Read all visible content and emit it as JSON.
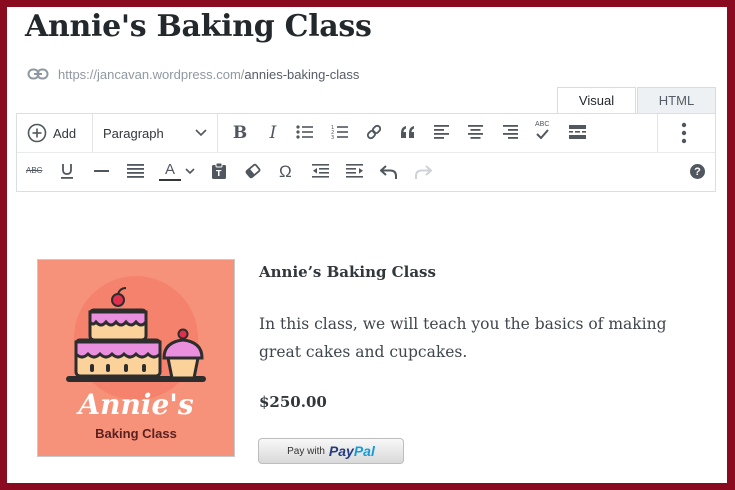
{
  "post": {
    "title": "Annie's Baking Class",
    "permalink_base": "https://jancavan.wordpress.com/",
    "permalink_slug": "annies-baking-class"
  },
  "editor_tabs": [
    {
      "label": "Visual",
      "active": true
    },
    {
      "label": "HTML",
      "active": false
    }
  ],
  "toolbar": {
    "add_label": "Add",
    "format_select": "Paragraph",
    "row1_icons": [
      "bold-icon",
      "italic-icon",
      "bullet-list-icon",
      "numbered-list-icon",
      "link-icon",
      "blockquote-icon",
      "align-left-icon",
      "align-center-icon",
      "align-right-icon",
      "spellcheck-icon",
      "read-more-icon",
      "more-options-icon"
    ],
    "row2_icons": [
      "strikethrough-icon",
      "underline-icon",
      "horizontal-line-icon",
      "justify-icon",
      "text-color-icon",
      "paste-text-icon",
      "clear-formatting-icon",
      "special-character-icon",
      "outdent-icon",
      "indent-icon",
      "undo-icon",
      "redo-icon",
      "help-icon"
    ],
    "strike_glyph": "ABC",
    "spell_glyph": "ABC",
    "textcolor_glyph": "A",
    "omega_glyph": "Ω",
    "help_glyph": "?"
  },
  "product": {
    "name": "Annie’s Baking Class",
    "description": "In this class, we will teach you the basics of making great cakes and cupcakes.",
    "price": "$250.00",
    "image_brand": "Annie's",
    "image_subtitle": "Baking Class",
    "paypal_prefix": "Pay with",
    "paypal_brand_a": "Pay",
    "paypal_brand_b": "Pal"
  },
  "colors": {
    "frame": "#8a0a1f",
    "image_bg": "#f7927a",
    "frosting": "#e98fdd",
    "cake": "#fbd39a"
  }
}
